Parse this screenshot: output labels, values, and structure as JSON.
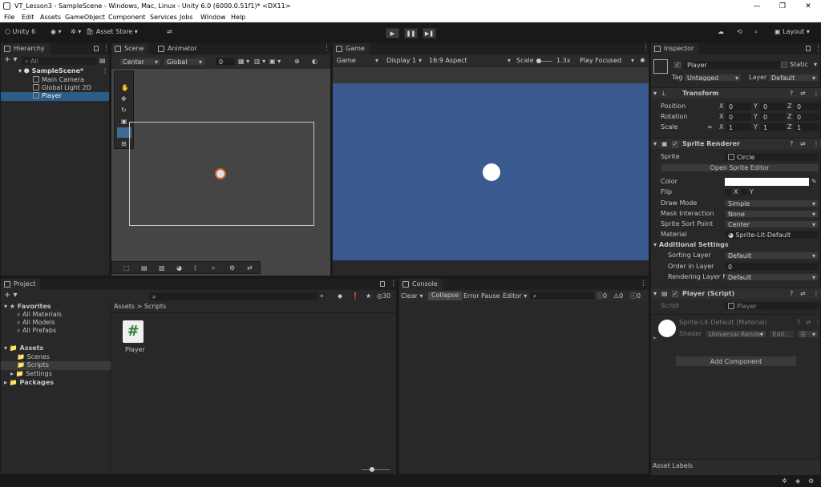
{
  "window": {
    "title": "VT_Lesson3 - SampleScene - Windows, Mac, Linux - Unity 6.0 (6000.0.51f1)* <DX11>",
    "minimize": "—",
    "maximize": "❐",
    "close": "✕"
  },
  "menu": [
    "File",
    "Edit",
    "Assets",
    "GameObject",
    "Component",
    "Services",
    "Jobs",
    "Window",
    "Help"
  ],
  "toolbar": {
    "unity": "Unity 6",
    "asset_store": "Asset Store",
    "layout": "Layout",
    "play": "▶",
    "pause": "❚❚",
    "step": "▶❚"
  },
  "hierarchy": {
    "tab": "Hierarchy",
    "search_placeholder": "All",
    "scene": "SampleScene*",
    "items": [
      "Main Camera",
      "Global Light 2D",
      "Player"
    ]
  },
  "scene": {
    "tab": "Scene",
    "tab2": "Animator",
    "pivot": "Center",
    "space": "Global",
    "snap_value": "0"
  },
  "game": {
    "tab": "Game",
    "mode": "Game",
    "display": "Display 1",
    "aspect": "16:9 Aspect",
    "scale_label": "Scale",
    "scale_value": "1.3x",
    "play_mode": "Play Focused",
    "bg": "#3a5a8f"
  },
  "inspector": {
    "tab": "Inspector",
    "name": "Player",
    "static": "Static",
    "tag_label": "Tag",
    "tag": "Untagged",
    "layer_label": "Layer",
    "layer": "Default",
    "transform": {
      "title": "Transform",
      "rows": [
        {
          "label": "Position",
          "x": "0",
          "y": "0",
          "z": "0"
        },
        {
          "label": "Rotation",
          "x": "0",
          "y": "0",
          "z": "0"
        },
        {
          "label": "Scale",
          "x": "1",
          "y": "1",
          "z": "1"
        }
      ]
    },
    "sprite_renderer": {
      "title": "Sprite Renderer",
      "sprite_label": "Sprite",
      "sprite": "Circle",
      "open_editor": "Open Sprite Editor",
      "color_label": "Color",
      "flip_label": "Flip",
      "flip_x": "X",
      "flip_y": "Y",
      "draw_mode_label": "Draw Mode",
      "draw_mode": "Simple",
      "mask_label": "Mask Interaction",
      "mask": "None",
      "sort_point_label": "Sprite Sort Point",
      "sort_point": "Center",
      "material_label": "Material",
      "material": "Sprite-Lit-Default",
      "additional": "Additional Settings",
      "sorting_layer_label": "Sorting Layer",
      "sorting_layer": "Default",
      "order_label": "Order in Layer",
      "order": "0",
      "rendering_layer_label": "Rendering Layer M",
      "rendering_layer": "Default"
    },
    "script": {
      "title": "Player (Script)",
      "script_label": "Script",
      "script": "Player"
    },
    "material": {
      "title": "Sprite-Lit-Default (Material)",
      "shader_label": "Shader",
      "shader": "Universal Render",
      "edit": "Edit..."
    },
    "add_component": "Add Component",
    "asset_labels": "Asset Labels"
  },
  "project": {
    "tab": "Project",
    "favorites": "Favorites",
    "fav_items": [
      "All Materials",
      "All Models",
      "All Prefabs"
    ],
    "assets": "Assets",
    "asset_items": [
      "Scenes",
      "Scripts",
      "Settings"
    ],
    "packages": "Packages",
    "breadcrumb": "Assets > Scripts",
    "file": "Player",
    "count": "30"
  },
  "console": {
    "tab": "Console",
    "clear": "Clear",
    "collapse": "Collapse",
    "error_pause": "Error Pause",
    "editor": "Editor",
    "c1": "0",
    "c2": "0",
    "c3": "0"
  }
}
